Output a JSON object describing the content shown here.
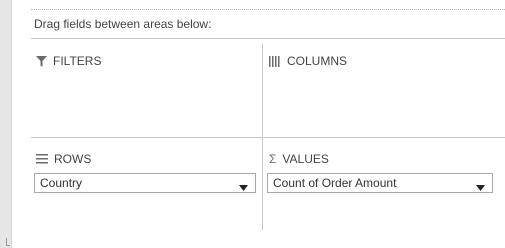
{
  "instruction": "Drag fields between areas below:",
  "areas": {
    "filters": {
      "label": "FILTERS",
      "icon": "filter-icon"
    },
    "columns": {
      "label": "COLUMNS",
      "icon": "columns-icon"
    },
    "rows": {
      "label": "ROWS",
      "icon": "rows-icon",
      "fields": [
        "Country"
      ]
    },
    "values": {
      "label": "VALUES",
      "icon": "sigma-icon",
      "icon_glyph": "Σ",
      "fields": [
        "Count of Order Amount"
      ]
    }
  },
  "colors": {
    "divider": "#c8c8c8",
    "text": "#444444",
    "icon": "#6b6b6b",
    "pill_border": "#a9a9a9"
  }
}
